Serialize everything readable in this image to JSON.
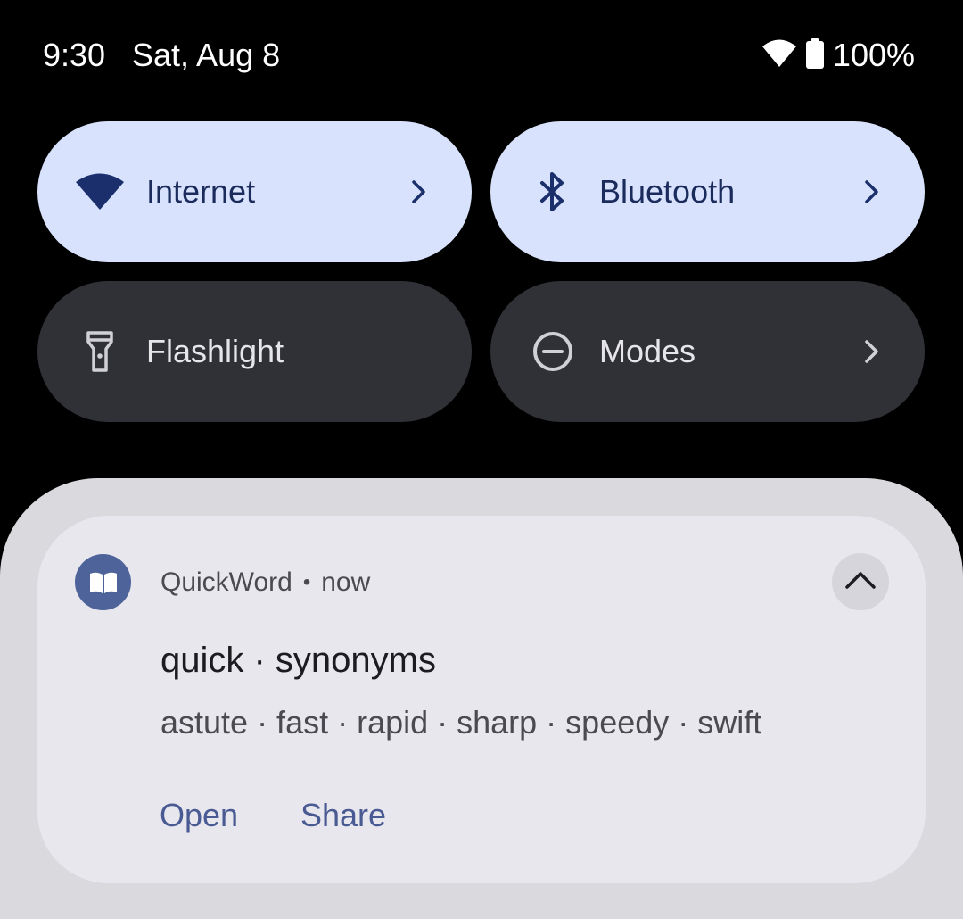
{
  "status_bar": {
    "time": "9:30",
    "date": "Sat, Aug 8",
    "battery": "100%",
    "wifi_icon": "wifi-icon",
    "battery_icon": "battery-icon"
  },
  "tiles": [
    {
      "label": "Internet",
      "icon": "wifi-icon",
      "state": "active",
      "has_chevron": true
    },
    {
      "label": "Bluetooth",
      "icon": "bluetooth-icon",
      "state": "active",
      "has_chevron": true
    },
    {
      "label": "Flashlight",
      "icon": "flashlight-icon",
      "state": "inactive",
      "has_chevron": false
    },
    {
      "label": "Modes",
      "icon": "do-not-disturb-icon",
      "state": "inactive",
      "has_chevron": true
    }
  ],
  "notification": {
    "app_name": "QuickWord",
    "separator": "•",
    "time": "now",
    "app_icon": "book-icon",
    "title": "quick · synonyms",
    "text": "astute · fast · rapid · sharp · speedy · swift",
    "actions": [
      "Open",
      "Share"
    ]
  },
  "colors": {
    "background": "#000000",
    "tile_active": "#d8e2fc",
    "tile_inactive": "#303136",
    "shade": "#d9d9de",
    "card": "#e8e7ee",
    "app_icon_bg": "#4d6399",
    "action_text": "#4a5a93"
  }
}
